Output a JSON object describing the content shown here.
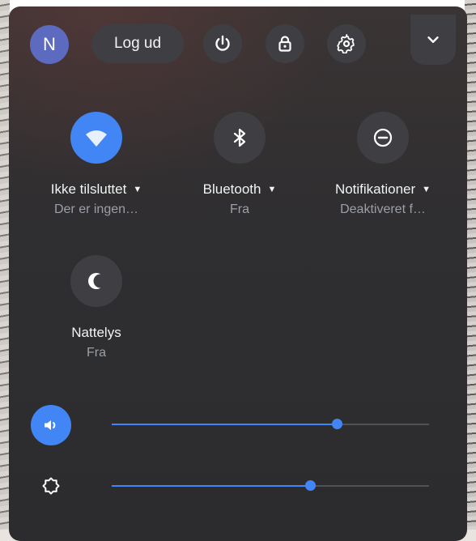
{
  "header": {
    "avatar_initial": "N",
    "logout_label": "Log ud"
  },
  "tiles": [
    {
      "label": "Ikke tilsluttet",
      "status": "Der er ingen…",
      "active": true
    },
    {
      "label": "Bluetooth",
      "status": "Fra",
      "active": false
    },
    {
      "label": "Notifikationer",
      "status": "Deaktiveret f…",
      "active": false
    },
    {
      "label": "Nattelys",
      "status": "Fra",
      "active": false
    }
  ],
  "sliders": {
    "volume": {
      "level": 0.71
    },
    "brightness": {
      "level": 0.625
    }
  },
  "icons": [
    "avatar",
    "power-icon",
    "lock-icon",
    "gear-icon",
    "chevron-down-icon",
    "wifi-icon",
    "bluetooth-icon",
    "do-not-disturb-icon",
    "night-light-icon",
    "volume-icon",
    "brightness-icon"
  ],
  "colors": {
    "accent": "#4285f4",
    "panel": "#2e2d30",
    "button": "#3f3f43"
  }
}
